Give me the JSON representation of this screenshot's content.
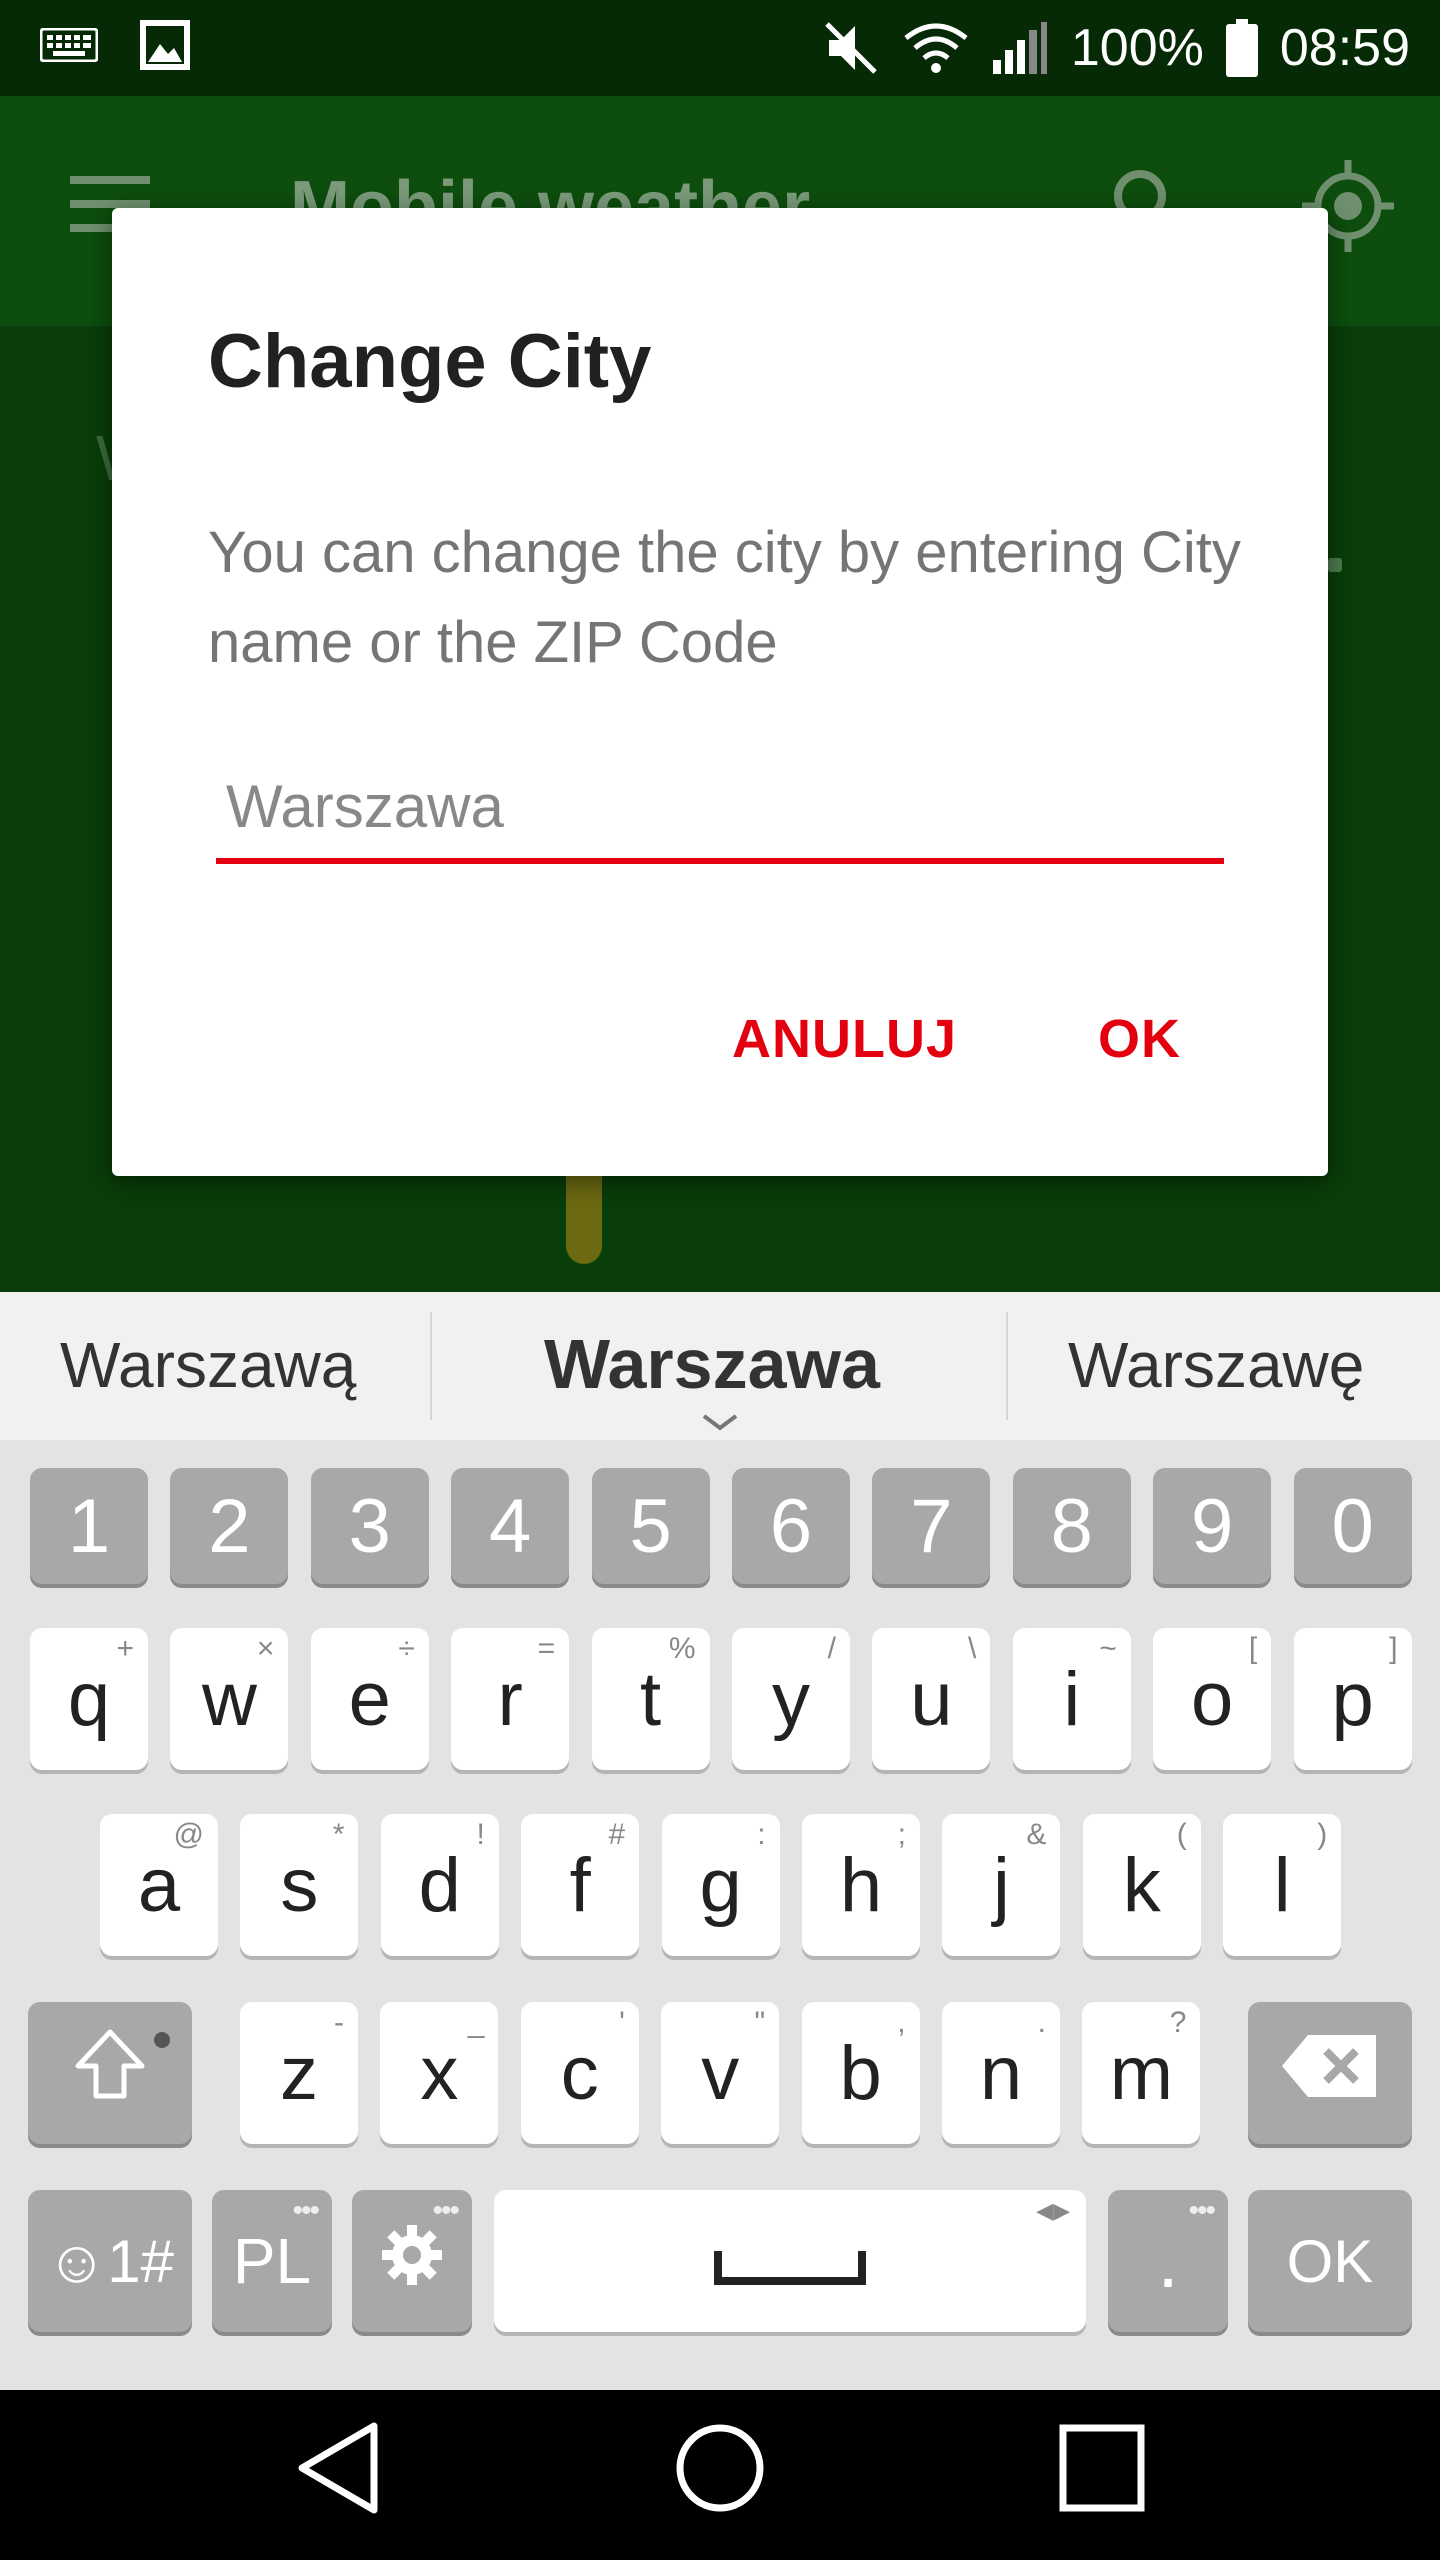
{
  "status_bar": {
    "battery": "100%",
    "time": "08:59",
    "icons": [
      "keyboard-icon",
      "image-icon",
      "mute-icon",
      "wifi-icon",
      "signal-icon",
      "battery-icon"
    ]
  },
  "app_bar": {
    "title": "Mobile weather"
  },
  "background": {
    "letter": "W"
  },
  "dialog": {
    "title": "Change City",
    "message": "You can change the city by entering City name or the ZIP Code",
    "input_value": "Warszawa",
    "cancel_label": "ANULUJ",
    "ok_label": "OK",
    "accent": "#e3000f"
  },
  "suggestions": {
    "left": "Warszawą",
    "center": "Warszawa",
    "right": "Warszawę"
  },
  "keyboard": {
    "numbers": [
      "1",
      "2",
      "3",
      "4",
      "5",
      "6",
      "7",
      "8",
      "9",
      "0"
    ],
    "row1": [
      {
        "key": "q",
        "hint": "+"
      },
      {
        "key": "w",
        "hint": "×"
      },
      {
        "key": "e",
        "hint": "÷"
      },
      {
        "key": "r",
        "hint": "="
      },
      {
        "key": "t",
        "hint": "%"
      },
      {
        "key": "y",
        "hint": "/"
      },
      {
        "key": "u",
        "hint": "\\"
      },
      {
        "key": "i",
        "hint": "~"
      },
      {
        "key": "o",
        "hint": "["
      },
      {
        "key": "p",
        "hint": "]"
      }
    ],
    "row2": [
      {
        "key": "a",
        "hint": "@"
      },
      {
        "key": "s",
        "hint": "*"
      },
      {
        "key": "d",
        "hint": "!"
      },
      {
        "key": "f",
        "hint": "#"
      },
      {
        "key": "g",
        "hint": ":"
      },
      {
        "key": "h",
        "hint": ";"
      },
      {
        "key": "j",
        "hint": "&"
      },
      {
        "key": "k",
        "hint": "("
      },
      {
        "key": "l",
        "hint": ")"
      }
    ],
    "row3": [
      {
        "key": "z",
        "hint": "-"
      },
      {
        "key": "x",
        "hint": "_"
      },
      {
        "key": "c",
        "hint": "'"
      },
      {
        "key": "v",
        "hint": "\""
      },
      {
        "key": "b",
        "hint": ","
      },
      {
        "key": "n",
        "hint": "."
      },
      {
        "key": "m",
        "hint": "?"
      }
    ],
    "symbols_label": "☺1#",
    "language_label": "PL",
    "period_label": ".",
    "ok_label": "OK"
  }
}
